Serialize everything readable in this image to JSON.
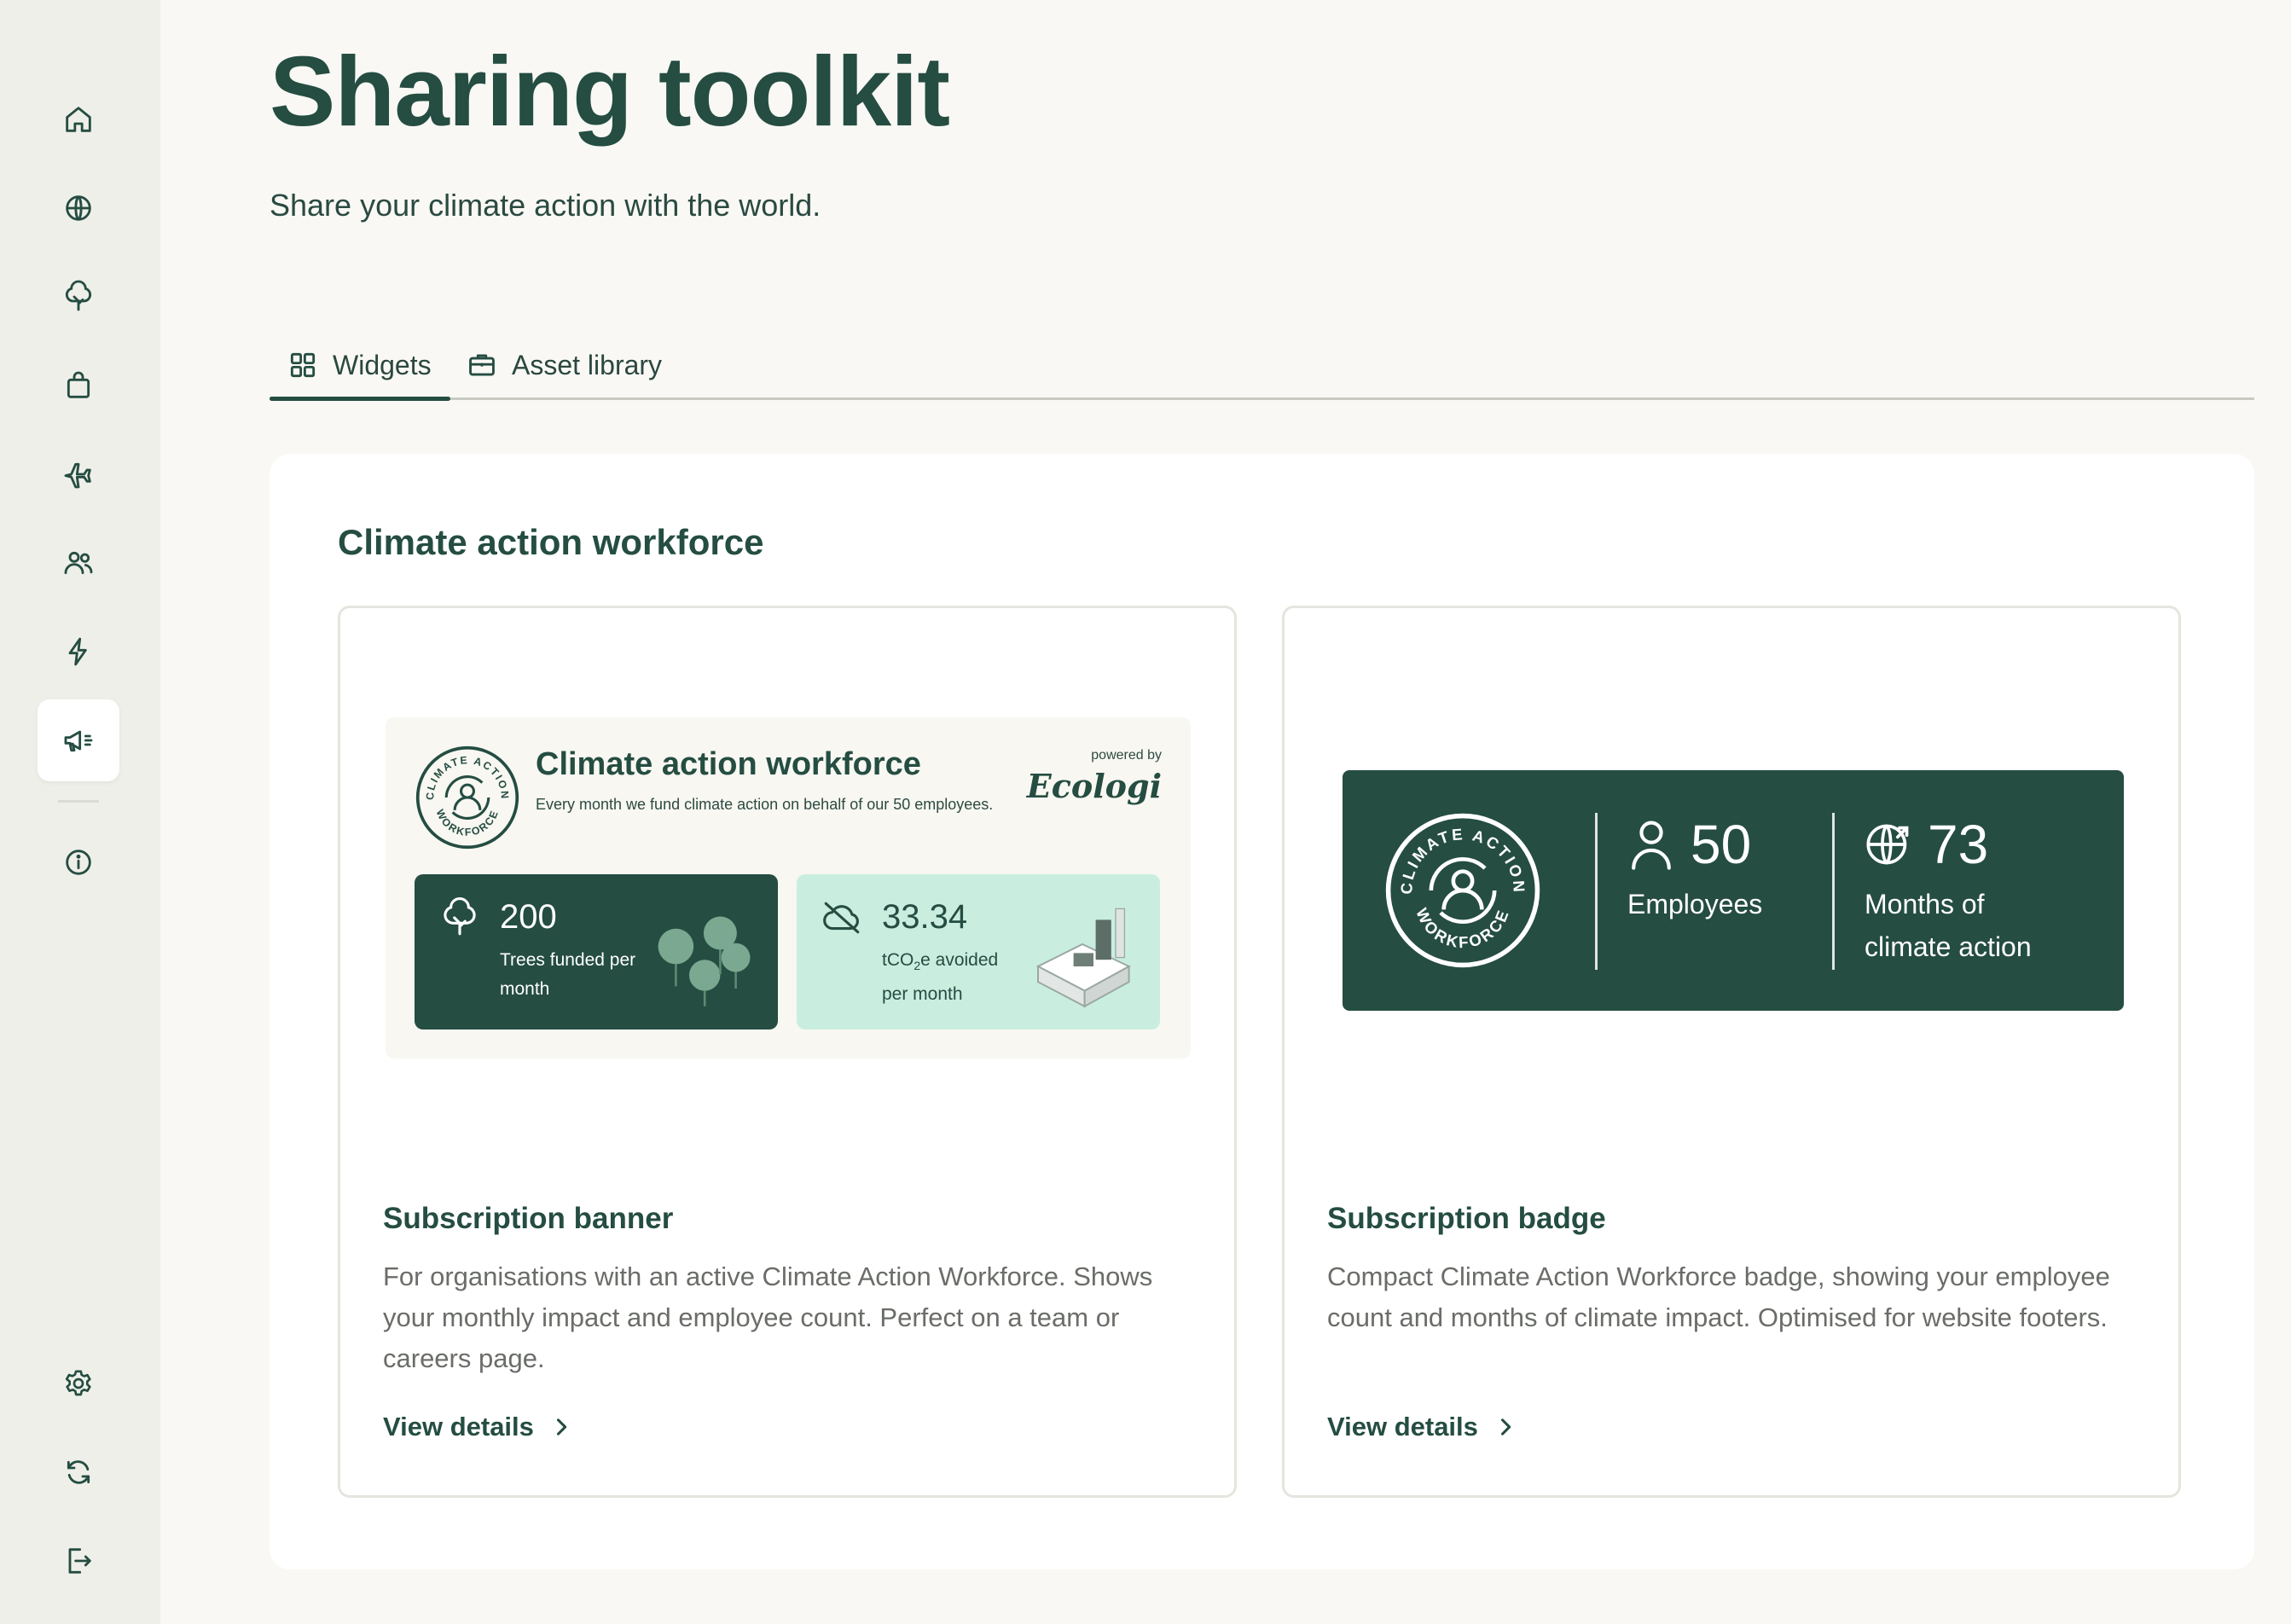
{
  "page": {
    "title": "Sharing toolkit",
    "subtitle": "Share your climate action with the world."
  },
  "sidebar": {
    "items": [
      {
        "icon": "home-icon"
      },
      {
        "icon": "globe-icon"
      },
      {
        "icon": "tree-icon"
      },
      {
        "icon": "shopping-bag-icon"
      },
      {
        "icon": "plane-icon"
      },
      {
        "icon": "users-icon"
      },
      {
        "icon": "lightning-icon"
      },
      {
        "icon": "megaphone-icon",
        "active": true
      },
      {
        "icon": "info-icon"
      },
      {
        "icon": "gear-icon"
      },
      {
        "icon": "refresh-icon"
      },
      {
        "icon": "logout-icon"
      }
    ]
  },
  "tabs": [
    {
      "label": "Widgets",
      "icon": "grid-icon",
      "active": true
    },
    {
      "label": "Asset library",
      "icon": "briefcase-icon"
    }
  ],
  "section": {
    "title": "Climate action workforce"
  },
  "cards": [
    {
      "title": "Subscription banner",
      "description": "For organisations with an active Climate Action Workforce. Shows your monthly impact and employee count. Perfect on a team or careers page.",
      "link": "View details",
      "preview": {
        "heading": "Climate action workforce",
        "subheading": "Every month we fund climate action on behalf of our 50 employees.",
        "powered_by": "powered by",
        "brand": "Ecologi",
        "badge_text_top": "CLIMATE ACTION",
        "badge_text_bottom": "WORKFORCE",
        "stats": [
          {
            "value": "200",
            "label": "Trees funded per month",
            "icon": "tree-icon"
          },
          {
            "value": "33.34",
            "label_prefix": "tCO",
            "label_sub": "2",
            "label_suffix": "e avoided per month",
            "icon": "cloud-off-icon"
          }
        ]
      }
    },
    {
      "title": "Subscription badge",
      "description": "Compact Climate Action Workforce badge, showing your employee count and months of climate impact. Optimised for website footers.",
      "link": "View details",
      "preview": {
        "badge_text_top": "CLIMATE ACTION",
        "badge_text_bottom": "WORKFORCE",
        "stats": [
          {
            "value": "50",
            "label": "Employees",
            "icon": "user-icon"
          },
          {
            "value": "73",
            "label_line1": "Months of",
            "label_line2": "climate action",
            "icon": "globe-arrow-icon"
          }
        ]
      }
    }
  ],
  "colors": {
    "brand_dark": "#254d42",
    "mint": "#c9eee0",
    "background": "#f9f8f4"
  }
}
